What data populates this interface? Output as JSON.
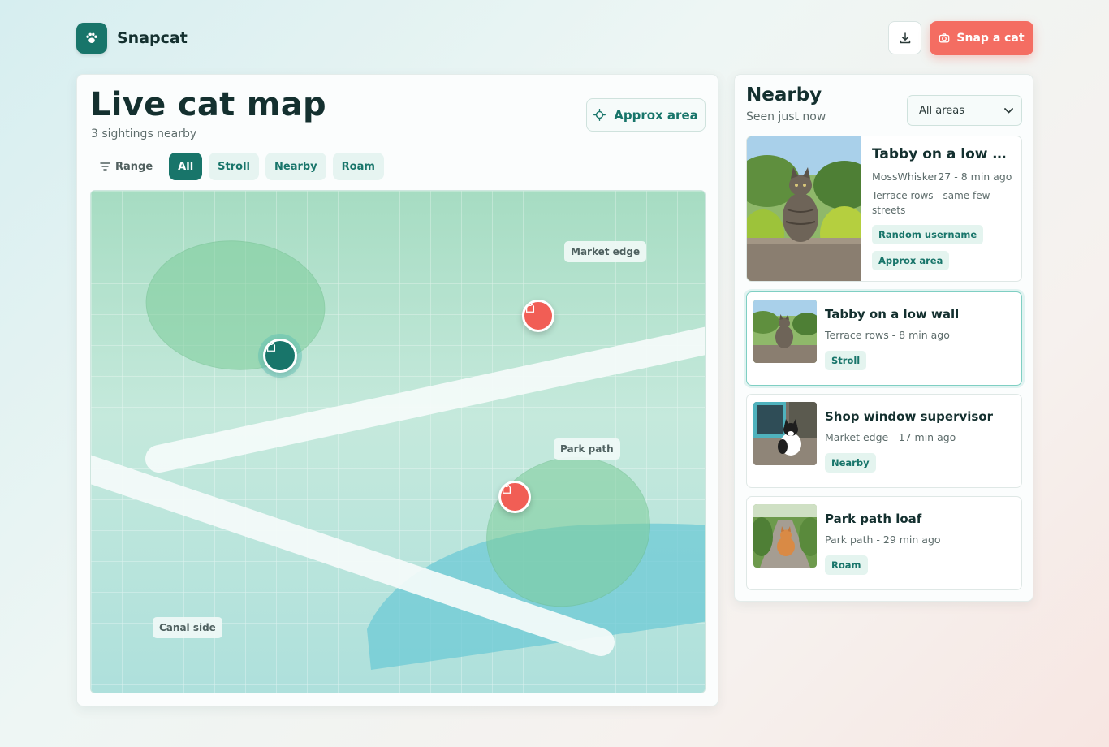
{
  "brand": {
    "name": "Snapcat",
    "icon": "paw-icon"
  },
  "header": {
    "download_icon": "download-icon",
    "snap_label": "Snap a cat",
    "snap_icon": "camera-icon"
  },
  "map_panel": {
    "title": "Live cat map",
    "subtitle": "3 sightings nearby",
    "approx_label": "Approx area",
    "filters": {
      "range_label": "Range",
      "chips": [
        "All",
        "Stroll",
        "Nearby",
        "Roam"
      ],
      "active": "All"
    },
    "labels": {
      "market": "Market edge",
      "park": "Park path",
      "canal": "Canal side"
    }
  },
  "nearby": {
    "title": "Nearby",
    "subtitle": "Seen just now",
    "area_select": {
      "selected": "All areas"
    },
    "featured": {
      "title": "Tabby on a low wall",
      "meta": "MossWhisker27 - 8 min ago",
      "note": "Terrace rows - same few streets",
      "tags": [
        "Random username",
        "Approx area"
      ]
    },
    "items": [
      {
        "title": "Tabby on a low wall",
        "meta": "Terrace rows - 8 min ago",
        "tag": "Stroll"
      },
      {
        "title": "Shop window supervisor",
        "meta": "Market edge - 17 min ago",
        "tag": "Nearby"
      },
      {
        "title": "Park path loaf",
        "meta": "Park path - 29 min ago",
        "tag": "Roam"
      }
    ]
  },
  "colors": {
    "brand": "#18756a",
    "accent": "#f46d62",
    "pin_red": "#f15e55"
  }
}
